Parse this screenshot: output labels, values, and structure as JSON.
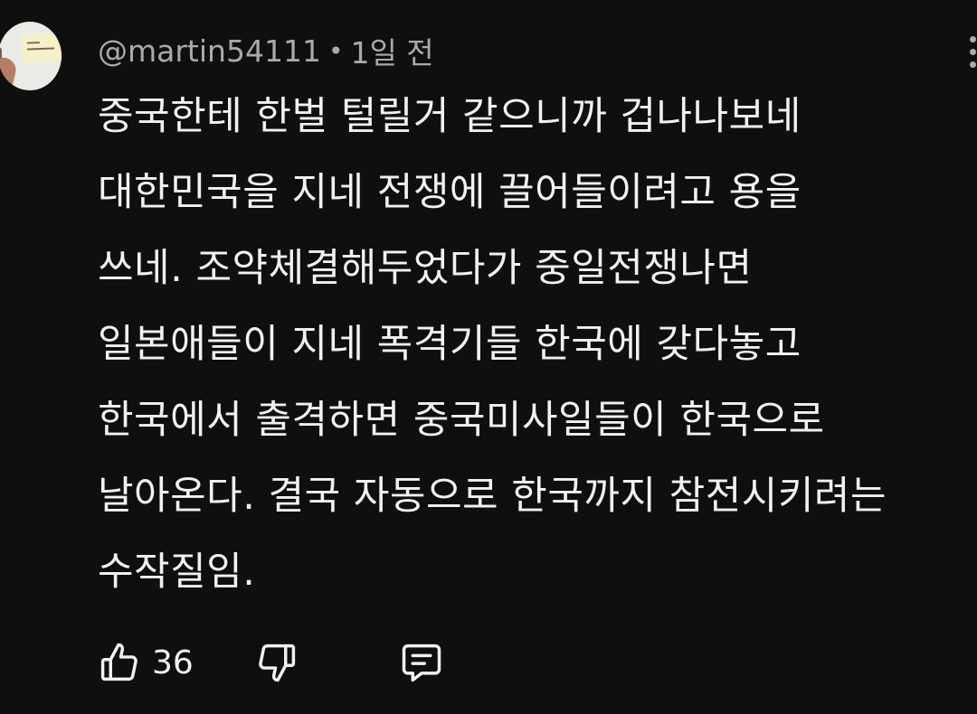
{
  "comment": {
    "author": "@martin54111",
    "separator": "•",
    "time": "1일 전",
    "lines": [
      "중국한테 한벌 털릴거 같으니까 겁나나보네",
      "대한민국을 지네 전쟁에 끌어들이려고 용을",
      "쓰네. 조약체결해두었다가 중일전쟁나면",
      "일본애들이 지네 폭격기들 한국에 갖다놓고",
      "한국에서 출격하면 중국미사일들이 한국으로",
      "날아온다. 결국 자동으로 한국까지 참전시키려는",
      "수작질임."
    ]
  },
  "actions": {
    "like_count": "36",
    "like_icon": "thumbs-up-icon",
    "dislike_icon": "thumbs-down-icon",
    "reply_icon": "comment-reply-icon",
    "menu_icon": "more-vert-icon"
  },
  "colors": {
    "background": "#0f0f0f",
    "text_primary": "#f1f1f1",
    "text_secondary": "#aaaaaa"
  }
}
